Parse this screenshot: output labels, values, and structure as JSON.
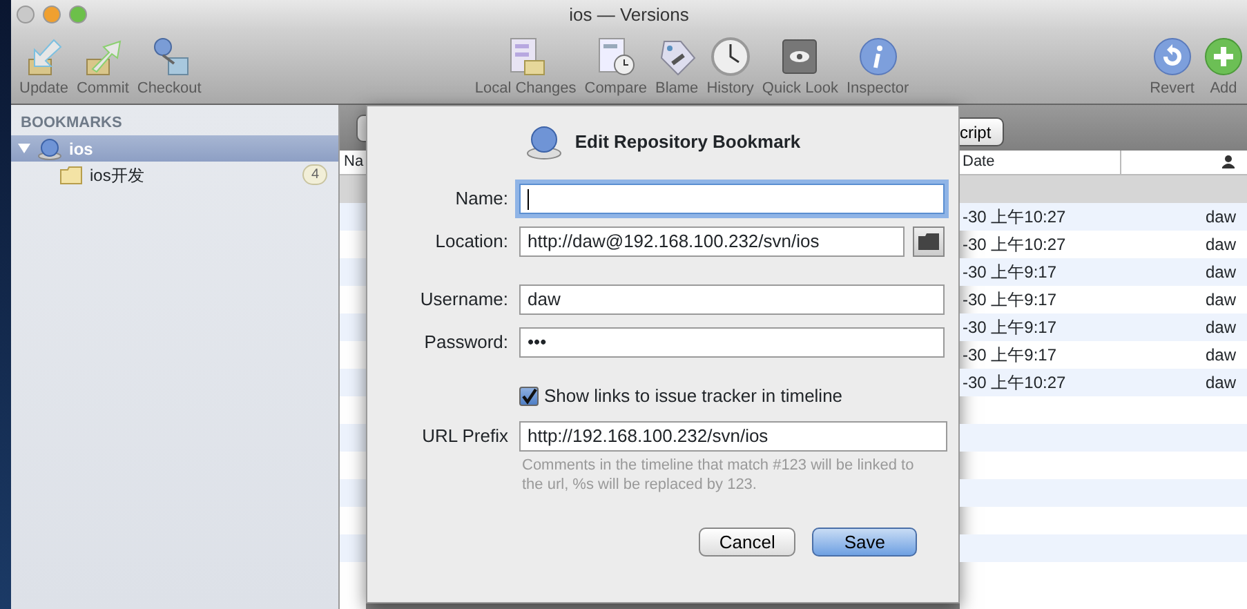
{
  "window": {
    "title": "ios — Versions"
  },
  "toolbar": {
    "left": [
      {
        "label": "Update"
      },
      {
        "label": "Commit"
      },
      {
        "label": "Checkout"
      }
    ],
    "center": [
      {
        "label": "Local Changes"
      },
      {
        "label": "Compare"
      },
      {
        "label": "Blame"
      },
      {
        "label": "History"
      },
      {
        "label": "Quick Look"
      },
      {
        "label": "Inspector"
      }
    ],
    "right": [
      {
        "label": "Revert"
      },
      {
        "label": "Add"
      }
    ]
  },
  "sidebar": {
    "header": "BOOKMARKS",
    "items": [
      {
        "label": "ios",
        "selected": true,
        "expanded": true,
        "children": [
          {
            "label": "ios开发",
            "badge": "4",
            "selected": false
          }
        ]
      }
    ]
  },
  "browser": {
    "segment_end": "cript",
    "columns": [
      "Na",
      "Date"
    ],
    "rows": [
      {
        "kind": "group"
      },
      {
        "kind": "file",
        "date": "-30 上午10:27",
        "user": "daw"
      },
      {
        "kind": "file",
        "date": "-30 上午10:27",
        "user": "daw"
      },
      {
        "kind": "file",
        "date": "-30 上午9:17",
        "user": "daw"
      },
      {
        "kind": "file",
        "date": "-30 上午9:17",
        "user": "daw"
      },
      {
        "kind": "file",
        "date": "-30 上午9:17",
        "user": "daw"
      },
      {
        "kind": "file",
        "date": "-30 上午9:17",
        "user": "daw"
      },
      {
        "kind": "file",
        "date": "-30 上午10:27",
        "user": "daw"
      }
    ]
  },
  "dialog": {
    "title": "Edit Repository Bookmark",
    "fields": [
      {
        "kind": "text",
        "label": "Name:",
        "focused": true
      },
      {
        "kind": "path",
        "label": "Location:",
        "value": "http://daw@192.168.100.232/svn/ios",
        "focused": false
      },
      {
        "kind": "text",
        "label": "Username:",
        "value": "daw",
        "focused": false
      },
      {
        "kind": "password",
        "label": "Password:",
        "value": "•••",
        "focused": false
      }
    ],
    "checkbox": {
      "label": "Show links to issue tracker in timeline",
      "checked": true
    },
    "url_prefix": {
      "label": "URL Prefix",
      "value": "http://192.168.100.232/svn/ios"
    },
    "help": "Comments in the timeline that match #123 will be linked to the url, %s will be replaced by 123.",
    "buttons": [
      {
        "label": "Cancel",
        "default": false
      },
      {
        "label": "Save",
        "default": true
      }
    ]
  }
}
